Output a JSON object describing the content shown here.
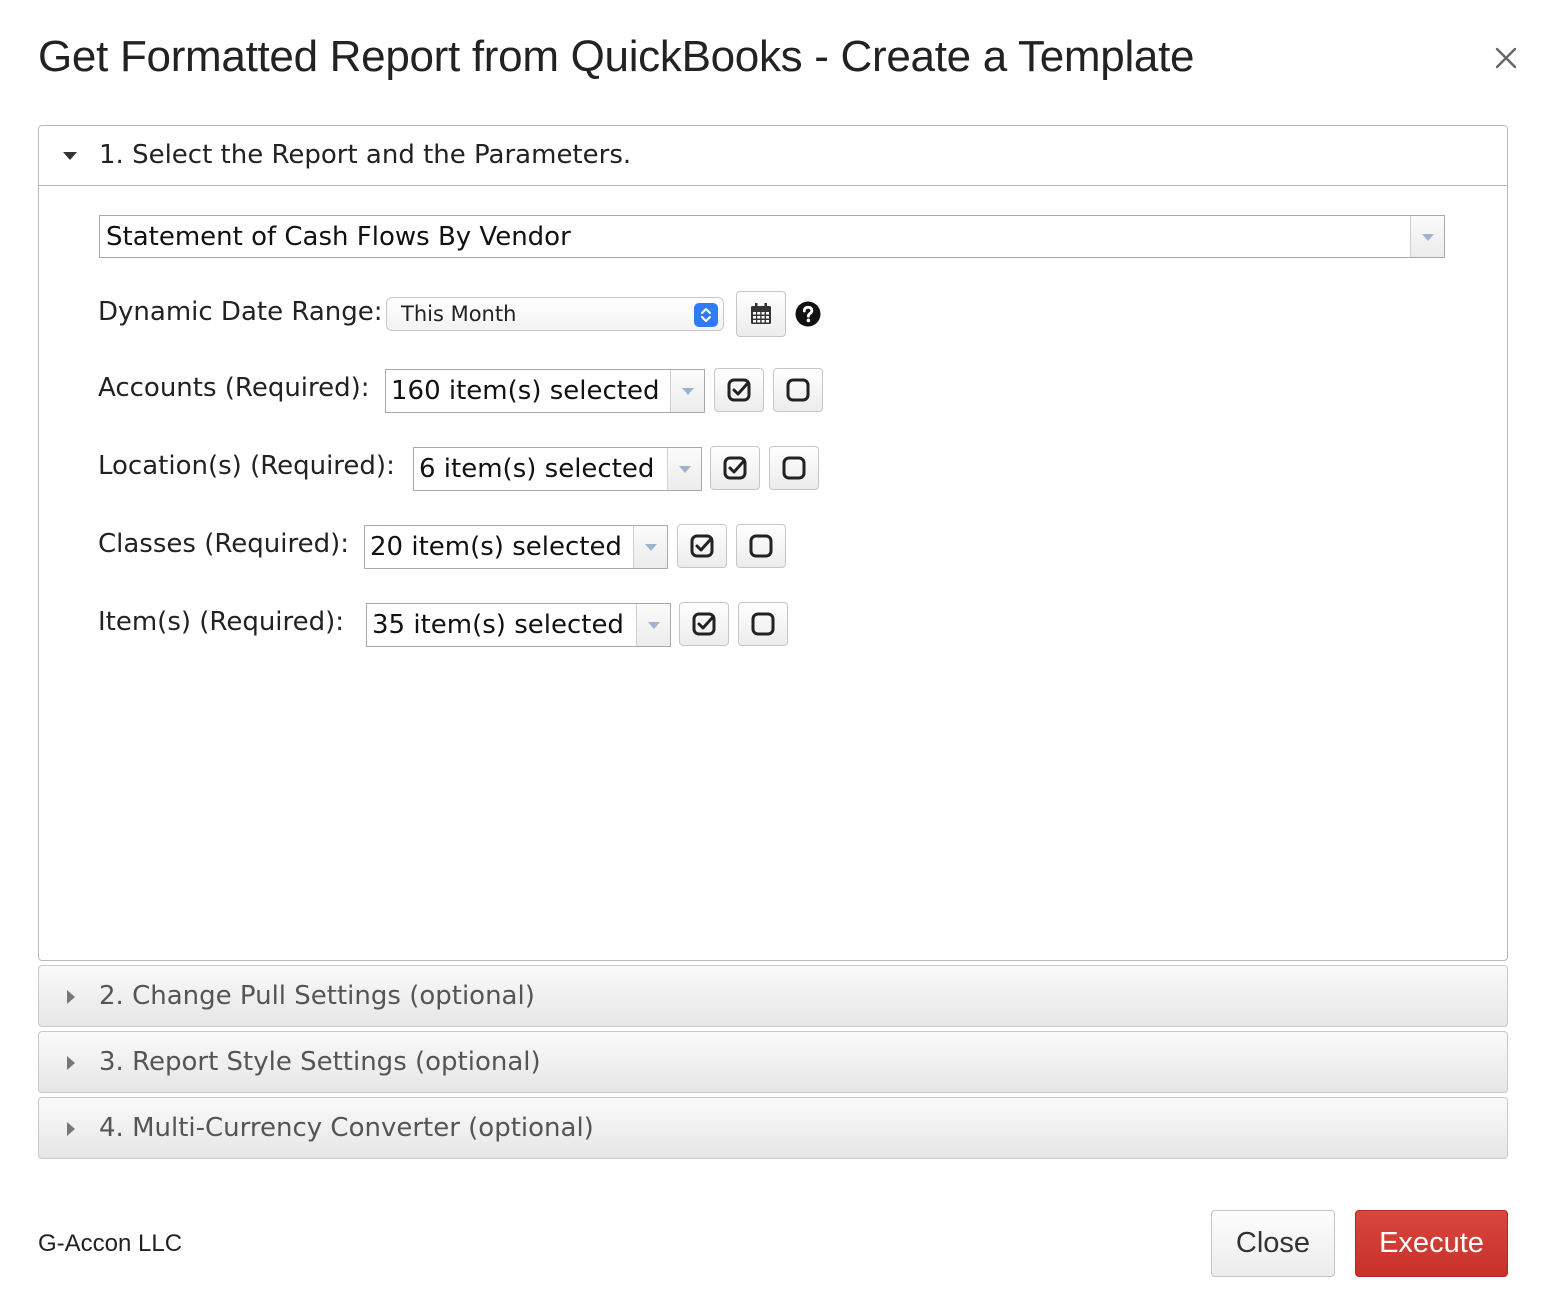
{
  "dialog": {
    "title": "Get Formatted Report from QuickBooks - Create a Template",
    "close_icon": "close-x-icon"
  },
  "section1": {
    "title": "1. Select the Report and the Parameters.",
    "report_value": "Statement of Cash Flows By Vendor",
    "date_range_label": "Dynamic Date Range:",
    "date_range_value": "This Month",
    "calendar_icon": "calendar-icon",
    "help_icon": "question-circle-icon",
    "accounts_label": "Accounts (Required):",
    "accounts_value": "160 item(s) selected",
    "locations_label": "Location(s) (Required):",
    "locations_value": "6 item(s) selected",
    "classes_label": "Classes (Required):",
    "classes_value": "20 item(s) selected",
    "items_label": "Item(s) (Required):",
    "items_value": "35 item(s) selected",
    "select_all_icon": "check-square-icon",
    "deselect_all_icon": "square-icon"
  },
  "section2": {
    "title": "2. Change Pull Settings (optional)"
  },
  "section3": {
    "title": "3. Report Style Settings (optional)"
  },
  "section4": {
    "title": "4. Multi-Currency Converter (optional)"
  },
  "footer": {
    "company": "G-Accon LLC",
    "close_label": "Close",
    "execute_label": "Execute"
  },
  "colors": {
    "execute": "#c8302a",
    "select_spinner": "#2f7cf6",
    "dropdown_arrow": "#9fb3d1"
  }
}
